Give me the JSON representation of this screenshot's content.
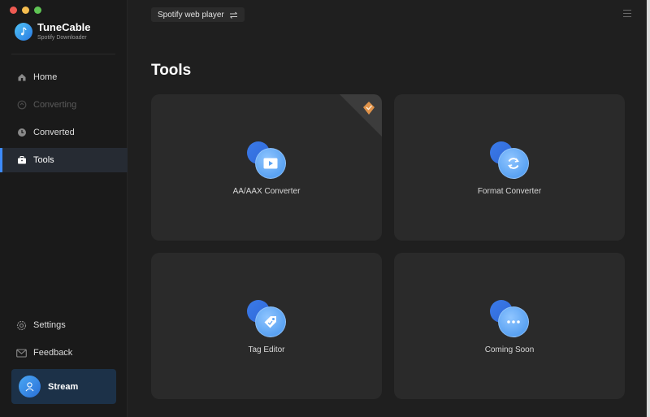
{
  "app": {
    "name": "TuneCable",
    "subtitle": "Spotify Downloader"
  },
  "sidebar": {
    "items": [
      {
        "label": "Home",
        "icon": "home-icon",
        "state": "normal"
      },
      {
        "label": "Converting",
        "icon": "converting-icon",
        "state": "disabled"
      },
      {
        "label": "Converted",
        "icon": "clock-icon",
        "state": "normal"
      },
      {
        "label": "Tools",
        "icon": "toolbox-icon",
        "state": "active"
      }
    ],
    "bottom_items": [
      {
        "label": "Settings",
        "icon": "gear-icon"
      },
      {
        "label": "Feedback",
        "icon": "mail-icon"
      }
    ],
    "stream_label": "Stream"
  },
  "topbar": {
    "source_label": "Spotify web player",
    "swap_icon": "swap-icon",
    "menu_icon": "hamburger-menu-icon"
  },
  "main": {
    "title": "Tools",
    "tools": [
      {
        "label": "AA/AAX Converter",
        "icon": "video-play-icon",
        "premium": true
      },
      {
        "label": "Format Converter",
        "icon": "refresh-icon",
        "premium": false
      },
      {
        "label": "Tag Editor",
        "icon": "tag-icon",
        "premium": false
      },
      {
        "label": "Coming Soon",
        "icon": "more-dots-icon",
        "premium": false
      }
    ]
  },
  "colors": {
    "accent": "#3d8bfd",
    "background": "#1f1f1f",
    "sidebar": "#1a1a1a",
    "card": "#2a2a2a",
    "stream_button": "#1c3148",
    "premium_badge": "#e0934a"
  }
}
